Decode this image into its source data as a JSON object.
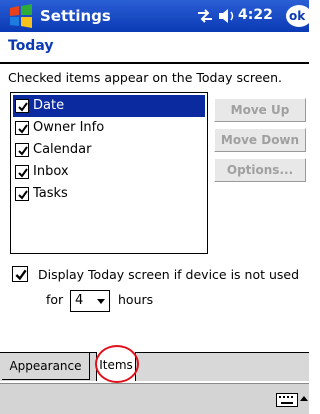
{
  "titlebar": {
    "app_title": "Settings",
    "clock": "4:22",
    "ok_label": "ok"
  },
  "page": {
    "title": "Today",
    "instructions": "Checked items appear on the Today screen."
  },
  "items_list": [
    {
      "label": "Date",
      "checked": true,
      "selected": true
    },
    {
      "label": "Owner Info",
      "checked": true,
      "selected": false
    },
    {
      "label": "Calendar",
      "checked": true,
      "selected": false
    },
    {
      "label": "Inbox",
      "checked": true,
      "selected": false
    },
    {
      "label": "Tasks",
      "checked": true,
      "selected": false
    }
  ],
  "buttons": {
    "move_up": "Move Up",
    "move_down": "Move Down",
    "options": "Options..."
  },
  "display_option": {
    "label": "Display Today screen if device is not used",
    "checked": true,
    "for_label": "for",
    "hours_value": "4",
    "hours_label": "hours"
  },
  "tabs": [
    {
      "label": "Appearance",
      "active": false
    },
    {
      "label": "Items",
      "active": true
    }
  ],
  "colors": {
    "titlebar": "#0b3ab4",
    "selection": "#0b2aa0",
    "highlight_circle": "#e0101a"
  }
}
